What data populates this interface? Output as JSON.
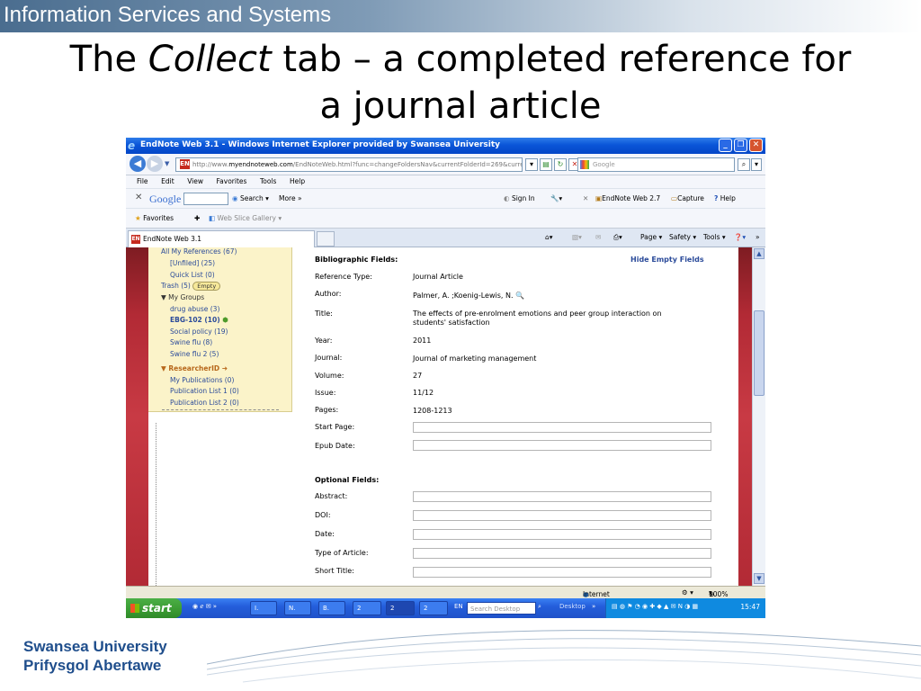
{
  "slide": {
    "header_text": "Information Services and Systems",
    "title_part1": "The ",
    "title_italic": "Collect",
    "title_part2": " tab – a completed reference for",
    "title_line2": "a journal article",
    "footer_line1": "Swansea University",
    "footer_line2": "Prifysgol Abertawe",
    "colors": {
      "header_blue": "#4a6d8f",
      "footer_blue": "#1f4e8c",
      "accent_red": "#b22a35"
    }
  },
  "browser": {
    "window_title": "EndNote Web 3.1 - Windows Internet Explorer provided by Swansea University",
    "url_prefix": "http://www.",
    "url_domain": "myendnoteweb.com",
    "url_rest": "/EndNoteWeb.html?func=changeFoldersNav&currentFolderId=269&curre",
    "search_placeholder": "Google",
    "menu": [
      "File",
      "Edit",
      "View",
      "Favorites",
      "Tools",
      "Help"
    ],
    "google_bar": {
      "logo": "Google",
      "search_label": "Search",
      "more_label": "More »",
      "sign_in": "Sign In",
      "endnote_label": "EndNote Web 2.7",
      "capture_label": "Capture",
      "help_label": "Help"
    },
    "favorites_label": "Favorites",
    "web_slice_label": "Web Slice Gallery",
    "tab_label": "EndNote Web 3.1",
    "tab_commands": {
      "page": "Page",
      "safety": "Safety",
      "tools": "Tools"
    },
    "status": {
      "zone": "Internet",
      "zoom": "100%"
    }
  },
  "sidebar": {
    "all_refs": "All My References (67)",
    "unfiled": "[Unfiled] (25)",
    "quick_list": "Quick List (0)",
    "trash": "Trash (5)",
    "empty_button": "Empty",
    "my_groups": "My Groups",
    "groups": [
      "drug abuse  (3)",
      "EBG-102  (10)",
      "Social policy  (19)",
      "Swine flu  (8)",
      "Swine flu 2  (5)"
    ],
    "researcher_id": "ResearcherID",
    "pubs": [
      "My Publications  (0)",
      "Publication List 1  (0)",
      "Publication List 2  (0)"
    ]
  },
  "reference": {
    "bib_heading": "Bibliographic Fields:",
    "hide_empty": "Hide Empty Fields",
    "fields": [
      {
        "label": "Reference Type:",
        "value": "Journal Article"
      },
      {
        "label": "Author:",
        "value": "Palmer, A.  ;Koenig-Lewis, N."
      },
      {
        "label": "Title:",
        "value": "The effects of pre-enrolment emotions and peer group interaction on",
        "value2": "students' satisfaction"
      },
      {
        "label": "Year:",
        "value": "2011"
      },
      {
        "label": "Journal:",
        "value": "Journal of marketing management"
      },
      {
        "label": "Volume:",
        "value": "27"
      },
      {
        "label": "Issue:",
        "value": "11/12"
      },
      {
        "label": "Pages:",
        "value": "1208-1213"
      }
    ],
    "empty_fields": [
      "Start Page:",
      "Epub Date:"
    ],
    "optional_heading": "Optional Fields:",
    "optional_fields": [
      "Abstract:",
      "DOI:",
      "Date:",
      "Type of Article:",
      "Short Title:"
    ]
  },
  "taskbar": {
    "start": "start",
    "buttons": [
      "I.",
      "N.",
      "B.",
      "2",
      "2",
      "2"
    ],
    "lang": "EN",
    "desktop_search": "Search Desktop",
    "desktop_label": "Desktop",
    "clock": "15:47"
  }
}
